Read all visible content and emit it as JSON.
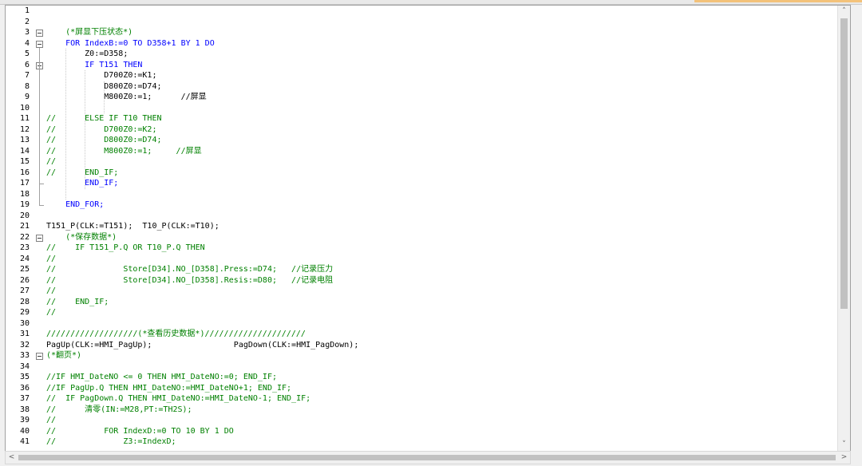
{
  "editor": {
    "lines": [
      {
        "n": "1",
        "text": ""
      },
      {
        "n": "2",
        "text": ""
      },
      {
        "n": "3",
        "text": "    (*屏显下压状态*)",
        "cls": "c-comment"
      },
      {
        "n": "4",
        "text": "    FOR IndexB:=0 TO D358+1 BY 1 DO",
        "cls": "c-kw"
      },
      {
        "n": "5",
        "text": "        Z0:=D358;"
      },
      {
        "n": "6",
        "text": "        IF T151 THEN",
        "cls": "c-kw"
      },
      {
        "n": "7",
        "text": "            D700Z0:=K1;"
      },
      {
        "n": "8",
        "text": "            D800Z0:=D74;"
      },
      {
        "n": "9",
        "text": "            M800Z0:=1;      //屏显"
      },
      {
        "n": "10",
        "text": ""
      },
      {
        "n": "11",
        "text": "//      ELSE IF T10 THEN",
        "cls": "c-comment"
      },
      {
        "n": "12",
        "text": "//          D700Z0:=K2;",
        "cls": "c-comment"
      },
      {
        "n": "13",
        "text": "//          D800Z0:=D74;",
        "cls": "c-comment"
      },
      {
        "n": "14",
        "text": "//          M800Z0:=1;     //屏显",
        "cls": "c-comment"
      },
      {
        "n": "15",
        "text": "//",
        "cls": "c-comment"
      },
      {
        "n": "16",
        "text": "//      END_IF;",
        "cls": "c-comment"
      },
      {
        "n": "17",
        "text": "        END_IF;",
        "cls": "c-kw"
      },
      {
        "n": "18",
        "text": ""
      },
      {
        "n": "19",
        "text": "    END_FOR;",
        "cls": "c-kw"
      },
      {
        "n": "20",
        "text": ""
      },
      {
        "n": "21",
        "text": "T151_P(CLK:=T151);  T10_P(CLK:=T10);"
      },
      {
        "n": "22",
        "text": "    (*保存数据*)",
        "cls": "c-comment"
      },
      {
        "n": "23",
        "text": "//    IF T151_P.Q OR T10_P.Q THEN",
        "cls": "c-comment"
      },
      {
        "n": "24",
        "text": "//",
        "cls": "c-comment"
      },
      {
        "n": "25",
        "text": "//              Store[D34].NO_[D358].Press:=D74;   //记录压力",
        "cls": "c-comment"
      },
      {
        "n": "26",
        "text": "//              Store[D34].NO_[D358].Resis:=D80;   //记录电阻",
        "cls": "c-comment"
      },
      {
        "n": "27",
        "text": "//",
        "cls": "c-comment"
      },
      {
        "n": "28",
        "text": "//    END_IF;",
        "cls": "c-comment"
      },
      {
        "n": "29",
        "text": "//",
        "cls": "c-comment"
      },
      {
        "n": "30",
        "text": ""
      },
      {
        "n": "31",
        "text": "///////////////////(*查看历史数据*)/////////////////////",
        "cls": "c-comment"
      },
      {
        "n": "32",
        "text": "PagUp(CLK:=HMI_PagUp);                 PagDown(CLK:=HMI_PagDown);"
      },
      {
        "n": "33",
        "text": "(*翻页*)",
        "cls": "c-comment"
      },
      {
        "n": "34",
        "text": ""
      },
      {
        "n": "35",
        "text": "//IF HMI_DateNO <= 0 THEN HMI_DateNO:=0; END_IF;",
        "cls": "c-comment"
      },
      {
        "n": "36",
        "text": "//IF PagUp.Q THEN HMI_DateNO:=HMI_DateNO+1; END_IF;",
        "cls": "c-comment"
      },
      {
        "n": "37",
        "text": "//  IF PagDown.Q THEN HMI_DateNO:=HMI_DateNO-1; END_IF;",
        "cls": "c-comment"
      },
      {
        "n": "38",
        "text": "//      清零(IN:=M28,PT:=TH2S);",
        "cls": "c-comment"
      },
      {
        "n": "39",
        "text": "//",
        "cls": "c-comment"
      },
      {
        "n": "40",
        "text": "//          FOR IndexD:=0 TO 10 BY 1 DO",
        "cls": "c-comment"
      },
      {
        "n": "41",
        "text": "//              Z3:=IndexD;",
        "cls": "c-comment"
      }
    ]
  },
  "colors": {
    "comment": "#008000",
    "keyword": "#0000ff",
    "function_block": "#d000d0"
  },
  "scrollbar": {
    "up_arrow": "˄",
    "down_arrow": "˅",
    "left_arrow": "<",
    "right_arrow": ">"
  }
}
